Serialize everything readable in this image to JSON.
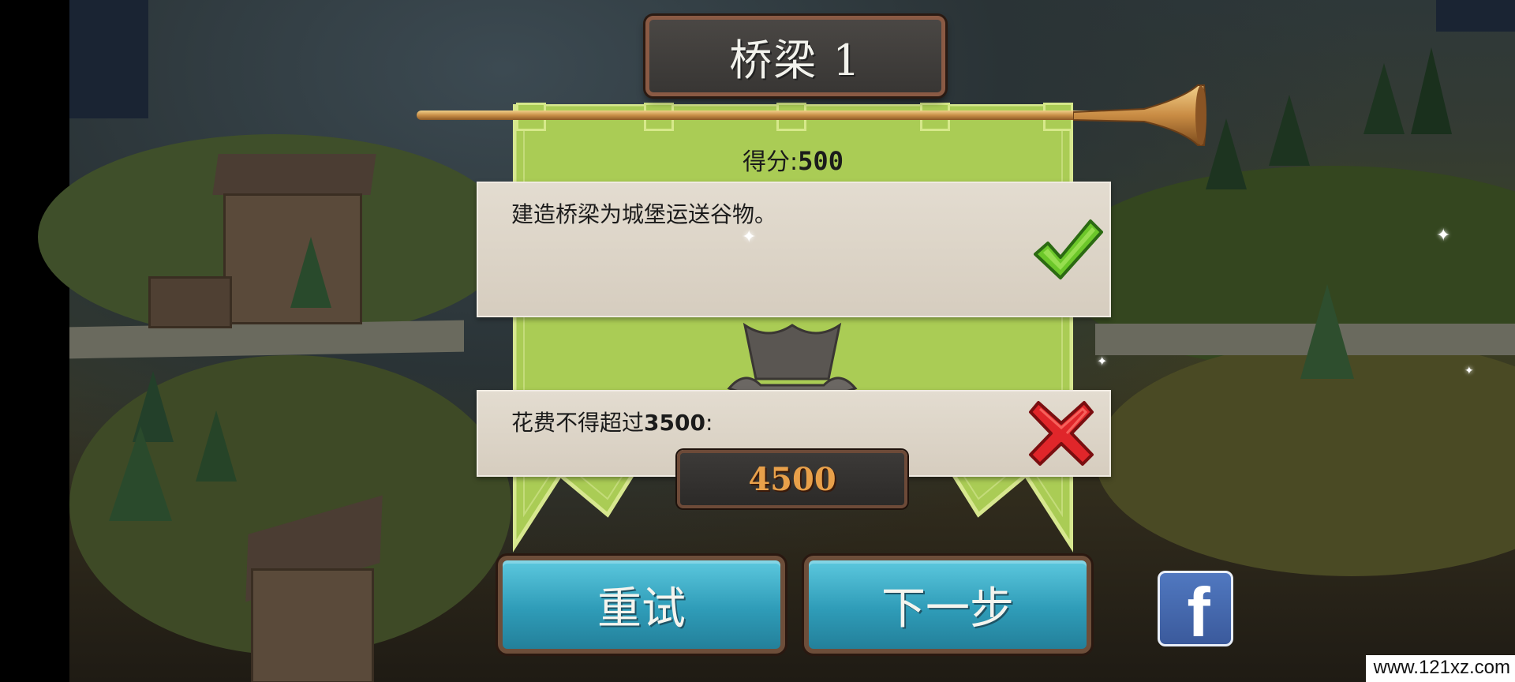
{
  "level": {
    "title": "桥梁 1"
  },
  "results": {
    "score_label": "得分:",
    "score_value": "500",
    "objectives": [
      {
        "text": "建造桥梁为城堡运送谷物。",
        "status": "success",
        "status_icon": "checkmark-icon",
        "status_color": "#6cc72a"
      },
      {
        "text_prefix": "花费不得超过",
        "text_limit": "3500",
        "text_suffix": ":",
        "status": "fail",
        "status_icon": "cross-icon",
        "status_color": "#e0262a",
        "actual_cost": "4500"
      }
    ]
  },
  "buttons": {
    "retry_label": "重试",
    "next_label": "下一步",
    "facebook_icon": "facebook-icon",
    "facebook_glyph": "f"
  },
  "watermark": "www.121xz.com",
  "colors": {
    "banner_green": "#aacc55",
    "button_blue": "#35a4c0",
    "cost_orange": "#e8a04a"
  }
}
